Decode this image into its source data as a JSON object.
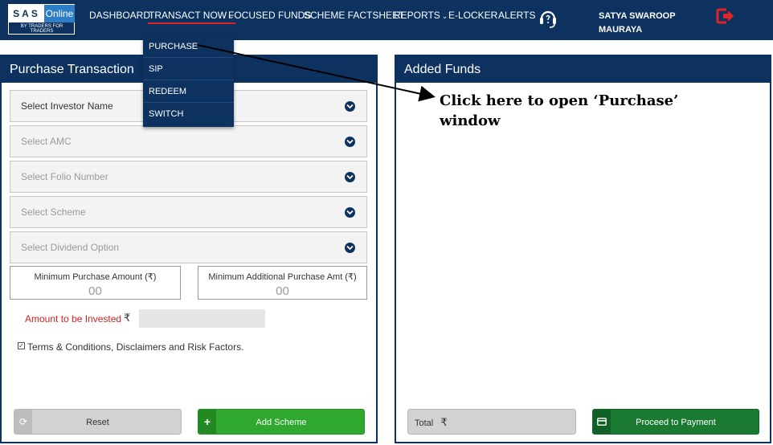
{
  "header": {
    "logo": {
      "sas": "SAS",
      "online": "Online",
      "tagline": "BY TRADERS FOR TRADERS"
    },
    "nav": [
      {
        "label": "DASHBOARD",
        "has_dropdown": false
      },
      {
        "label": "TRANSACT NOW",
        "has_dropdown": true,
        "active": true
      },
      {
        "label": "FOCUSED FUNDS",
        "has_dropdown": false
      },
      {
        "label": "SCHEME FACTSHEET",
        "has_dropdown": false
      },
      {
        "label": "REPORTS",
        "has_dropdown": true
      },
      {
        "label": "E-LOCKER",
        "has_dropdown": false
      },
      {
        "label": "ALERTS",
        "has_dropdown": false
      }
    ],
    "support_icon": "headset-icon",
    "user_line1": "SATYA SWAROOP",
    "user_line2": "MAURAYA",
    "logout_icon": "logout-icon"
  },
  "dropdown": {
    "items": [
      {
        "label": "PURCHASE"
      },
      {
        "label": "SIP"
      },
      {
        "label": "REDEEM"
      },
      {
        "label": "SWITCH"
      }
    ]
  },
  "left_panel": {
    "title": "Purchase Transaction",
    "selects": [
      {
        "label": "Select Investor Name"
      },
      {
        "label": "Select AMC"
      },
      {
        "label": "Select Folio Number"
      },
      {
        "label": "Select Scheme"
      },
      {
        "label": "Select Dividend Option"
      }
    ],
    "min_purchase": {
      "label": "Minimum Purchase Amount (₹)",
      "value": "00"
    },
    "min_additional": {
      "label": "Minimum Additional Purchase Amt (₹)",
      "value": "00"
    },
    "amount_label": "Amount to be Invested",
    "currency": "₹",
    "amount_value": "",
    "terms": "Terms & Conditions, Disclaimers and Risk Factors.",
    "terms_checked": true,
    "reset_label": "Reset",
    "add_label": "Add Scheme"
  },
  "right_panel": {
    "title": "Added Funds",
    "total_label": "Total",
    "currency": "₹",
    "proceed_label": "Proceed to Payment"
  },
  "annotation": {
    "line1": "Click here to open ‘Purchase’",
    "line2": "window"
  },
  "colors": {
    "navy": "#0d3260",
    "accent_red": "#e02424",
    "green": "#2ea82e",
    "dark_green": "#1a7a32"
  }
}
